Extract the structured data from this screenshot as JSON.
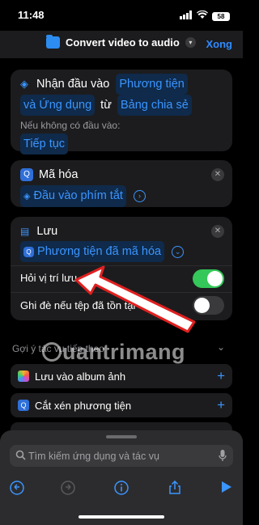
{
  "status": {
    "time": "11:48",
    "battery": "58"
  },
  "nav": {
    "title": "Convert video to audio",
    "done": "Xong"
  },
  "receive": {
    "label": "Nhận đầu vào",
    "token1": "Phương tiện",
    "token2": "và Ứng dụng",
    "from": "từ",
    "token3": "Bảng chia sẻ",
    "no_input_label": "Nếu không có đầu vào:",
    "continue": "Tiếp tục"
  },
  "encode": {
    "title": "Mã hóa",
    "input_token": "Đầu vào phím tắt"
  },
  "save": {
    "title": "Lưu",
    "token": "Phương tiện đã mã hóa",
    "ask_location": "Hỏi vị trí lưu",
    "ask_location_on": true,
    "overwrite": "Ghi đè nếu tệp đã tồn tại",
    "overwrite_on": false
  },
  "suggestions": {
    "header": "Gợi ý tác vụ tiếp theo",
    "items": [
      {
        "label": "Lưu vào album ảnh"
      },
      {
        "label": "Cắt xén phương tiện"
      }
    ]
  },
  "search": {
    "placeholder": "Tìm kiếm ứng dụng và tác vụ"
  },
  "watermark": "uantrimang",
  "colors": {
    "accent": "#3b95ff",
    "toggle_on": "#34c759",
    "card": "#1c1c1e"
  }
}
